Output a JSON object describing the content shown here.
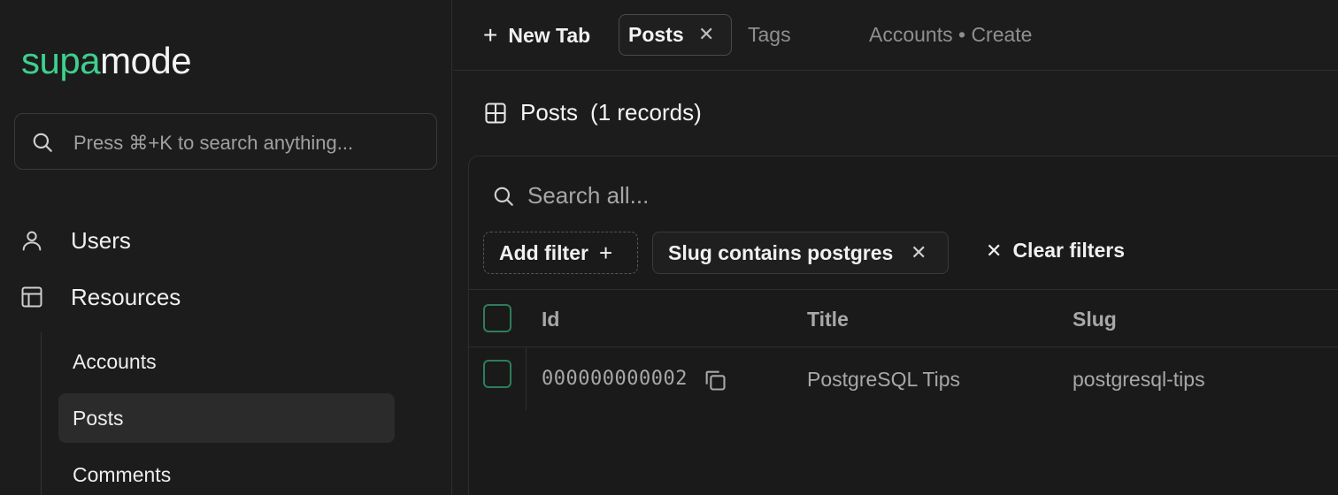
{
  "brand": {
    "accent": "supa",
    "rest": "mode",
    "accent_color": "#3ecf8e"
  },
  "sidebar": {
    "search_placeholder": "Press ⌘+K to search anything...",
    "items": [
      {
        "label": "Users",
        "icon": "user-icon"
      },
      {
        "label": "Resources",
        "icon": "table-layout-icon"
      }
    ],
    "resources": [
      {
        "label": "Accounts",
        "active": false
      },
      {
        "label": "Posts",
        "active": true
      },
      {
        "label": "Comments",
        "active": false
      }
    ]
  },
  "tabs": {
    "new_tab_label": "New Tab",
    "items": [
      {
        "label": "Posts",
        "active": true
      },
      {
        "label": "Tags",
        "active": false
      },
      {
        "label": "Accounts • Create",
        "active": false
      }
    ]
  },
  "page": {
    "title": "Posts",
    "count": "(1 records)"
  },
  "table": {
    "search_placeholder": "Search all...",
    "add_filter_label": "Add filter",
    "filter_chip_label": "Slug contains postgres",
    "clear_filters_label": "Clear filters",
    "columns": [
      "Id",
      "Title",
      "Slug"
    ],
    "rows": [
      {
        "id": "000000000002",
        "title": "PostgreSQL Tips",
        "slug": "postgresql-tips"
      }
    ]
  }
}
